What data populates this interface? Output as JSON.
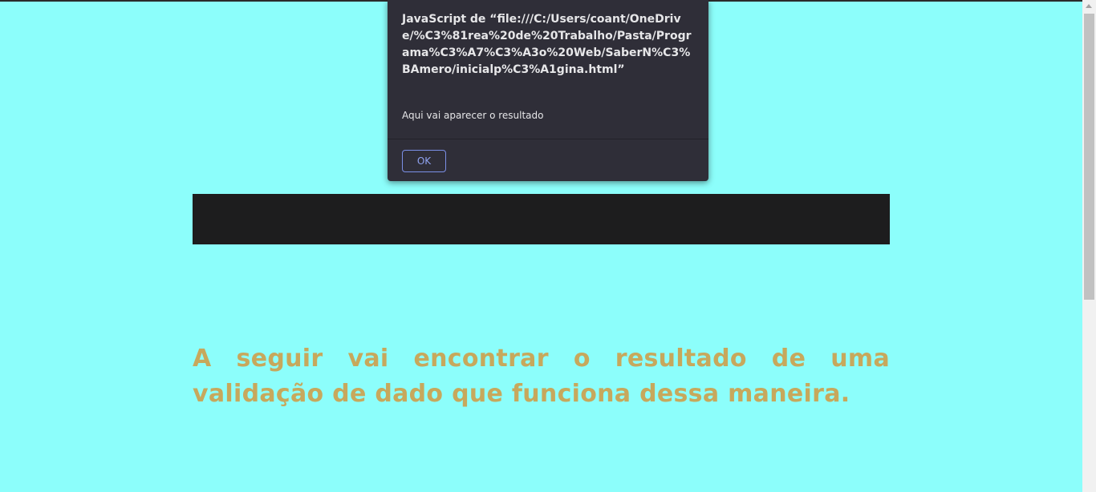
{
  "dialog": {
    "title": "JavaScript de “file:///C:/Users/coant/OneDrive/%C3%81rea%20de%20Trabalho/Pasta/Programa%C3%A7%C3%A3o%20Web/SaberN%C3%BAmero/inicialp%C3%A1gina.html”",
    "message": "Aqui vai aparecer o resultado",
    "ok_label": "OK"
  },
  "page": {
    "intro_text": "A seguir vai encontrar o resultado de uma validação de dado que funciona dessa maneira."
  },
  "colors": {
    "background": "#8cfefb",
    "text_accent": "#c7a85c",
    "bar": "#1d1d1e",
    "dialog_bg": "#2f2e38",
    "button_border": "#7b8fe6"
  }
}
